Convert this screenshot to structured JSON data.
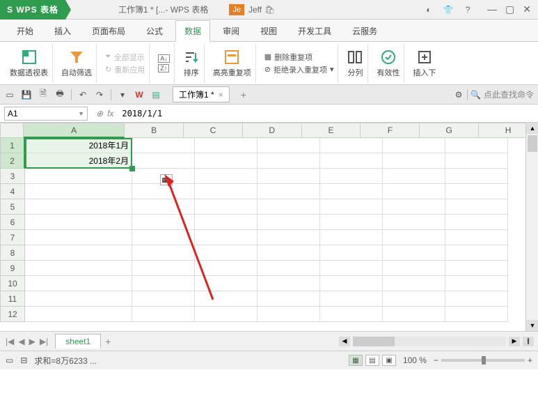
{
  "app_name": "S WPS 表格",
  "title_doc": "工作簿1 * [...- WPS 表格",
  "user_badge": "Je",
  "user_name": "Jeff",
  "menu": [
    "开始",
    "插入",
    "页面布局",
    "公式",
    "数据",
    "审阅",
    "视图",
    "开发工具",
    "云服务"
  ],
  "active_menu_index": 4,
  "ribbon": {
    "pivot": "数据透视表",
    "autofilter": "自动筛选",
    "show_all": "全部显示",
    "reapply": "重新应用",
    "sort": "排序",
    "highlight_dup": "高亮重复项",
    "remove_dup": "删除重复项",
    "reject_dup": "拒绝录入重复项",
    "split": "分列",
    "validation": "有效性",
    "insert": "插入下"
  },
  "quick": {
    "doc_tab": "工作簿1 *",
    "find_cmd": "点此查找命令"
  },
  "namebox": "A1",
  "formula": "2018/1/1",
  "columns": [
    "A",
    "B",
    "C",
    "D",
    "E",
    "F",
    "G",
    "H"
  ],
  "rows": [
    1,
    2,
    3,
    4,
    5,
    6,
    7,
    8,
    9,
    10,
    11,
    12
  ],
  "cells": {
    "A1": "2018年1月",
    "A2": "2018年2月"
  },
  "sheet_name": "sheet1",
  "status_sum": "求和=8万6233 ...",
  "zoom": "100 %"
}
